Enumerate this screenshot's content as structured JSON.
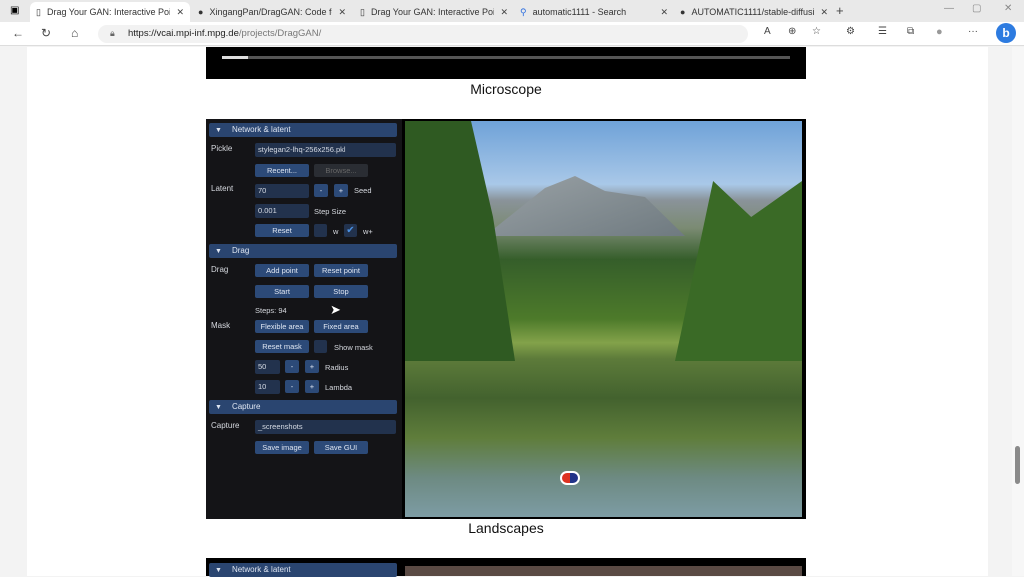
{
  "browser": {
    "tabs": [
      {
        "label": "Drag Your GAN: Interactive Point",
        "active": true
      },
      {
        "label": "XingangPan/DragGAN: Code for",
        "active": false
      },
      {
        "label": "Drag Your GAN: Interactive Point",
        "active": false
      },
      {
        "label": "automatic1111 - Search",
        "active": false
      },
      {
        "label": "AUTOMATIC1111/stable-diffusio",
        "active": false
      }
    ],
    "url_host": "https://vcai.mpi-inf.mpg.de",
    "url_path": "/projects/DragGAN/"
  },
  "page": {
    "caption_1": "Microscope",
    "caption_2": "Landscapes",
    "gui": {
      "network_header": "Network & latent",
      "pickle_label": "Pickle",
      "pickle_value": "stylegan2-lhq-256x256.pkl",
      "recent": "Recent...",
      "browse": "Browse...",
      "latent_label": "Latent",
      "seed_value": "70",
      "minus": "-",
      "plus": "+",
      "seed_label": "Seed",
      "step_size_value": "0.001",
      "step_size_label": "Step Size",
      "reset": "Reset",
      "w_label": "w",
      "wplus_label": "w+",
      "w_plus_checked": true,
      "drag_header": "Drag",
      "drag_label": "Drag",
      "add_point": "Add point",
      "reset_point": "Reset point",
      "start": "Start",
      "stop": "Stop",
      "steps": "Steps: 94",
      "mask_label": "Mask",
      "flexible_area": "Flexible area",
      "fixed_area": "Fixed area",
      "reset_mask": "Reset mask",
      "show_mask": "Show mask",
      "radius_value": "50",
      "radius_label": "Radius",
      "lambda_value": "10",
      "lambda_label": "Lambda",
      "capture_header": "Capture",
      "capture_label": "Capture",
      "capture_value": "_screenshots",
      "save_image": "Save image",
      "save_gui": "Save GUI"
    },
    "next_header": "Network & latent"
  }
}
